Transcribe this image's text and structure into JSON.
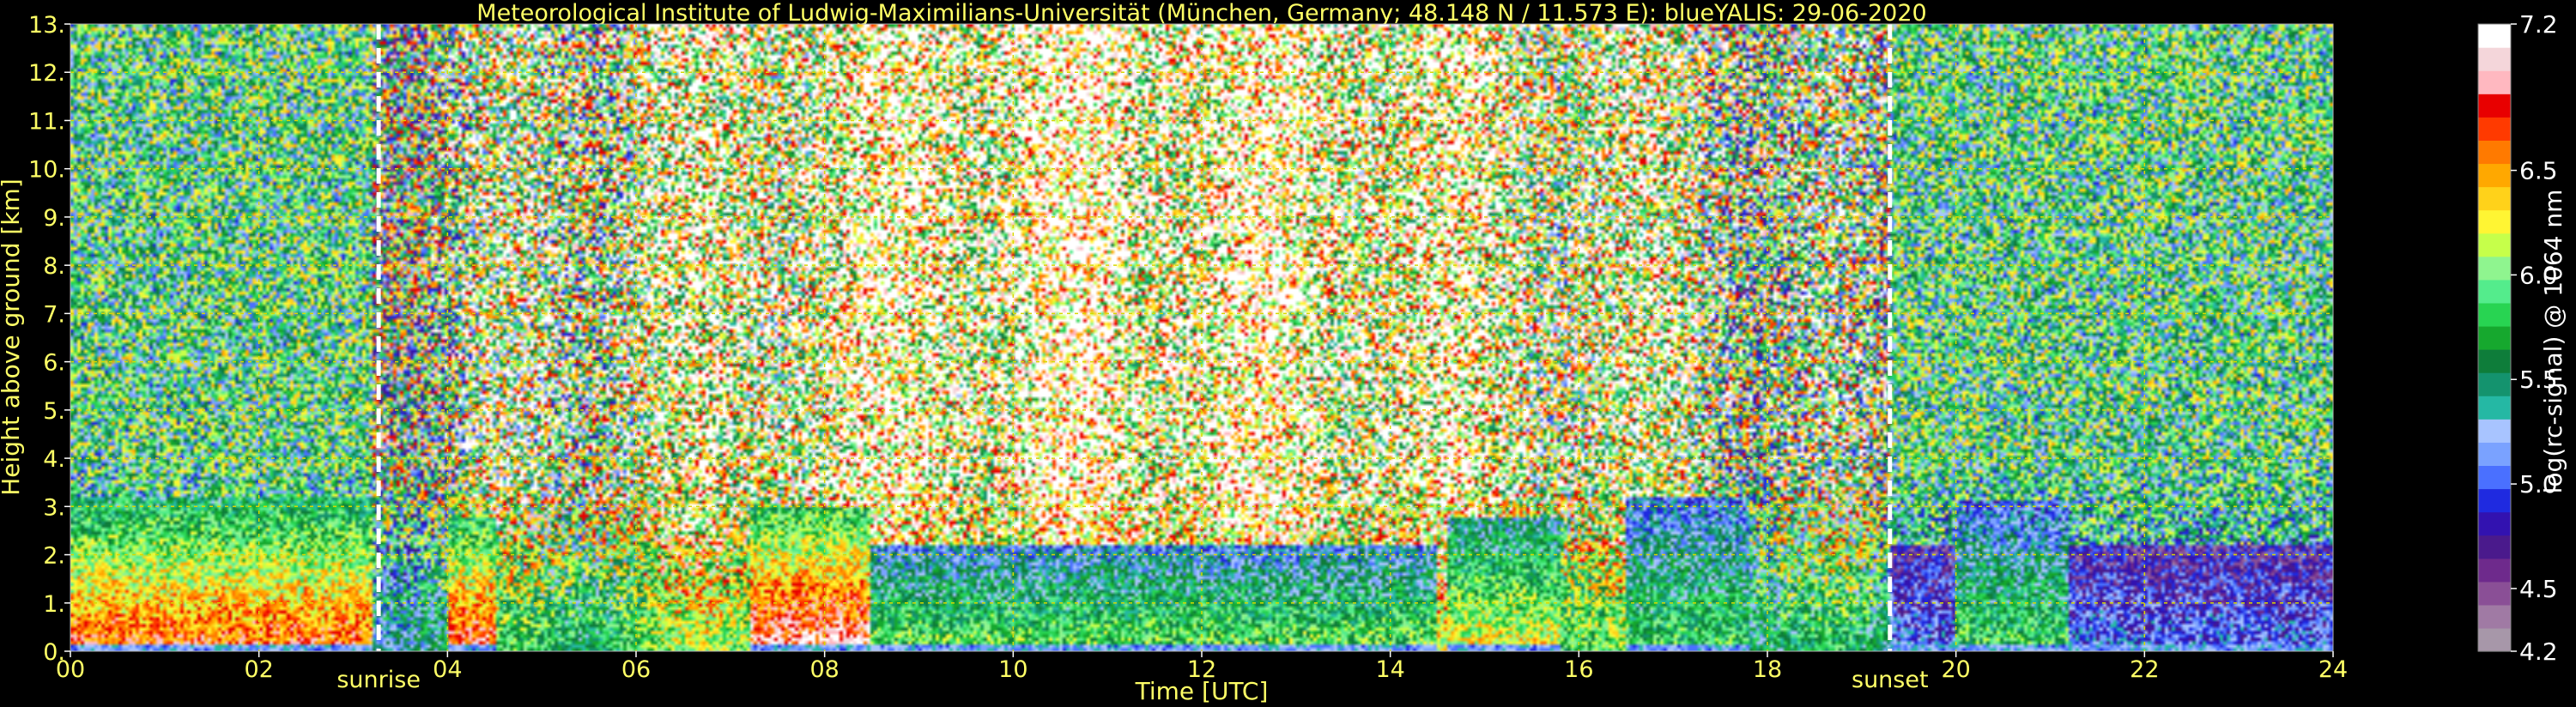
{
  "chart_data": {
    "type": "heatmap",
    "title": "Meteorological Institute of Ludwig-Maximilians-Universität (München, Germany; 48.148 N / 11.573 E):     blueYALIS: 29-06-2020",
    "xlabel": "Time [UTC]",
    "ylabel": "Height above ground [km]",
    "xlim": [
      0,
      24
    ],
    "ylim": [
      0,
      13
    ],
    "x_ticks": [
      "00",
      "02",
      "04",
      "06",
      "08",
      "10",
      "12",
      "14",
      "16",
      "18",
      "20",
      "22",
      "24"
    ],
    "y_ticks": [
      "0.",
      "1.",
      "2.",
      "3.",
      "4.",
      "5.",
      "6.",
      "7.",
      "8.",
      "9.",
      "10.",
      "11.",
      "12.",
      "13."
    ],
    "grid": true,
    "colorbar": {
      "label": "log(rc-signal) @ 1064 nm",
      "range": [
        4.2,
        7.2
      ],
      "ticks": [
        "4.2",
        "4.5",
        "5.0",
        "5.5",
        "6.0",
        "6.5",
        "7.2"
      ],
      "colors": [
        "#a797a9",
        "#a07aa4",
        "#8a4f96",
        "#6e2a8c",
        "#4a1a8c",
        "#3212b0",
        "#1f2ae0",
        "#4a70ff",
        "#7aa2ff",
        "#a8c4ff",
        "#25b8a4",
        "#14936e",
        "#0e7d3a",
        "#16a82e",
        "#28d452",
        "#54ec8c",
        "#8ff58f",
        "#c6ff4a",
        "#fff533",
        "#ffd21a",
        "#ffa800",
        "#ff7a00",
        "#ff3a00",
        "#e80000",
        "#ffb8c0",
        "#f4d6da",
        "#ffffff"
      ]
    },
    "markers": [
      {
        "label": "sunrise",
        "time": 3.27
      },
      {
        "label": "sunset",
        "time": 19.3
      }
    ],
    "regions": [
      {
        "t0": 0.0,
        "t1": 3.2,
        "h_top": 3.2,
        "z": 0.85
      },
      {
        "t0": 4.0,
        "t1": 4.5,
        "h_top": 2.8,
        "z": 0.9
      },
      {
        "t0": 7.2,
        "t1": 8.5,
        "h_top": 3.0,
        "z": 0.95
      },
      {
        "t0": 8.5,
        "t1": 14.5,
        "h_top": 2.2,
        "z": 0.6
      },
      {
        "t0": 14.6,
        "t1": 15.8,
        "h_top": 2.8,
        "z": 0.7
      },
      {
        "t0": 16.5,
        "t1": 17.8,
        "h_top": 3.2,
        "z": 0.55
      },
      {
        "t0": 19.3,
        "t1": 24.0,
        "h_top": 2.2,
        "z": 0.3
      },
      {
        "t0": 20.0,
        "t1": 21.2,
        "h_top": 3.1,
        "z": 0.55
      }
    ],
    "colors": {
      "title": "#ffff66",
      "axis_text": "#ffff66",
      "grid": "#d8d800",
      "marker": "#ffffff",
      "colorbar_text": "#ffffff",
      "background": "#000000"
    }
  }
}
